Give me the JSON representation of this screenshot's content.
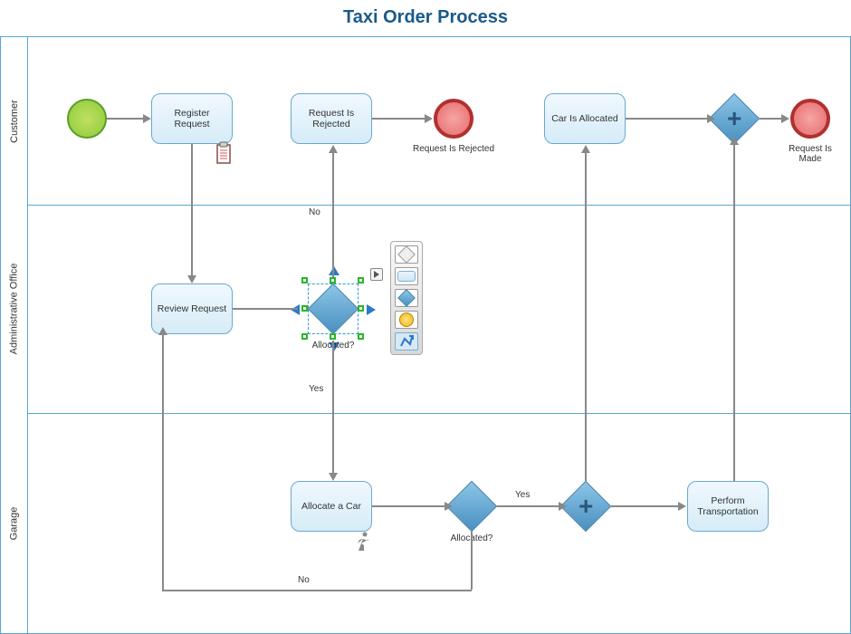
{
  "title": "Taxi Order Process",
  "lanes": {
    "customer": "Customer",
    "admin": "Administrative Office",
    "garage": "Garage"
  },
  "tasks": {
    "register_request": "Register Request",
    "request_is_rejected": "Request Is Rejected",
    "car_is_allocated": "Car Is Allocated",
    "review_request": "Review Request",
    "allocate_a_car": "Allocate a Car",
    "perform_transportation": "Perform Transportation"
  },
  "events": {
    "end_rejected_label": "Request Is Rejected",
    "end_made_label": "Request Is Made"
  },
  "edges": {
    "no": "No",
    "yes": "Yes",
    "allocated": "Allocated?",
    "allocated2": "Allocated?"
  },
  "icons": {
    "clipboard": "clipboard-icon",
    "running": "running-person-icon",
    "play": "play-icon",
    "smart_arrow": "arrow-icon"
  }
}
